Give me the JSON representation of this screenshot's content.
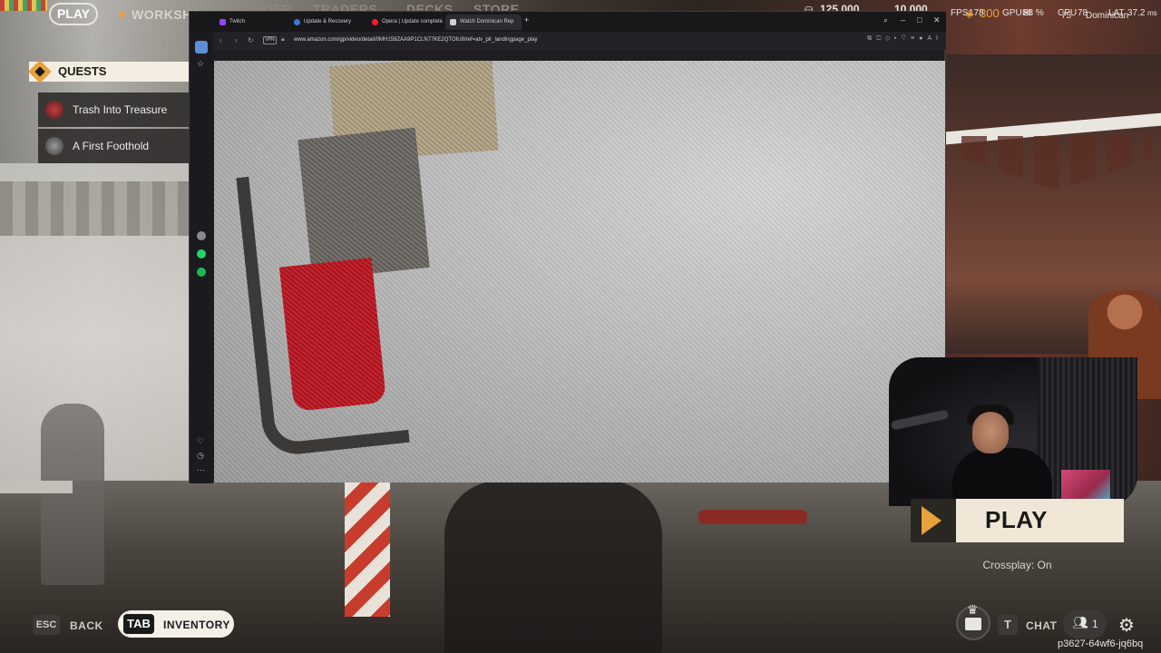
{
  "game": {
    "top_nav": {
      "play": "PLAY",
      "workshop": "WORKSHO",
      "raider": "RAIDER",
      "traders": "TRADERS",
      "decks": "DECKS",
      "store": "STORE"
    },
    "currency": "125,000",
    "currency2": "10,000",
    "hud": {
      "fps_label": "FPS",
      "fps_value": "178",
      "coins": "300",
      "gpu_label": "GPU",
      "gpu_value": "88 %",
      "cpu_label": "CPU",
      "cpu_value": "78",
      "level": "75",
      "username": "Dominican",
      "lat_label": "LAT",
      "lat_value": "37.2",
      "lat_unit": "ms"
    },
    "quests": {
      "title": "QUESTS",
      "items": [
        {
          "label": "Trash Into Treasure"
        },
        {
          "label": "A First Foothold"
        }
      ]
    },
    "play_button": "PLAY",
    "crossplay": "Crossplay: On",
    "bottom": {
      "esc_key": "ESC",
      "back": "BACK",
      "tab_key": "TAB",
      "inventory": "INVENTORY",
      "t_key": "T",
      "chat": "CHAT",
      "party_count": "1",
      "session_id": "p3627-64wf6-jq6bq"
    }
  },
  "browser": {
    "tabs": [
      {
        "label": "Twitch",
        "favicon_color": "#9146ff"
      },
      {
        "label": "Update & Recovery",
        "favicon_color": "#3a7bd5"
      },
      {
        "label": "Opera | Update complete",
        "favicon_color": "#ff1b2d"
      },
      {
        "label": "Watch Dominican Rep",
        "favicon_color": "#cfcfd4",
        "active": true
      }
    ],
    "vpn": "VPN",
    "url": "www.amazon.com/gp/video/detail/0MH159ZAA9P1CLN77KE2QTOIU8/ref=atv_plr_landingpage_play",
    "ai_label": "AI"
  },
  "colors": {
    "accent": "#e8a23a",
    "play_bg": "#f0e7d6",
    "dark": "#2a2622"
  }
}
